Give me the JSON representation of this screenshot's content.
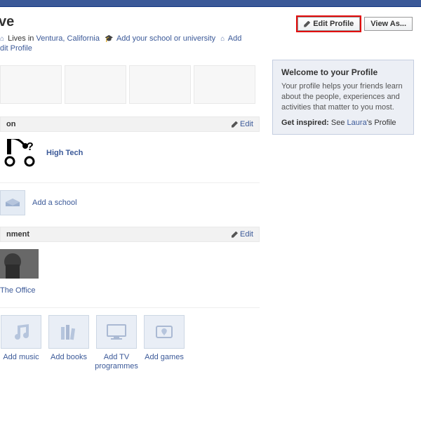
{
  "header": {
    "title_fragment": "ve",
    "lives_in_label": "Lives in",
    "lives_in_value": "Ventura, California",
    "add_school_label": "Add your school or university",
    "add_more_label": "Add",
    "small_edit_profile": "dit Profile",
    "edit_profile_btn": "Edit Profile",
    "view_as_btn": "View As..."
  },
  "sections": {
    "education": {
      "title_fragment": "on",
      "edit": "Edit",
      "item_name": "High Tech",
      "add_school": "Add a school"
    },
    "entertainment": {
      "title_fragment": "nment",
      "edit": "Edit",
      "item_name": "The Office"
    }
  },
  "tiles": {
    "music": "Add music",
    "books": "Add books",
    "tv": "Add TV programmes",
    "games": "Add games"
  },
  "welcome": {
    "title": "Welcome to your Profile",
    "body": "Your profile helps your friends learn about the people, experiences and activities that matter to you most.",
    "inspire_label": "Get inspired:",
    "inspire_text_before": "See ",
    "inspire_link": "Laura",
    "inspire_text_after": "'s Profile"
  }
}
